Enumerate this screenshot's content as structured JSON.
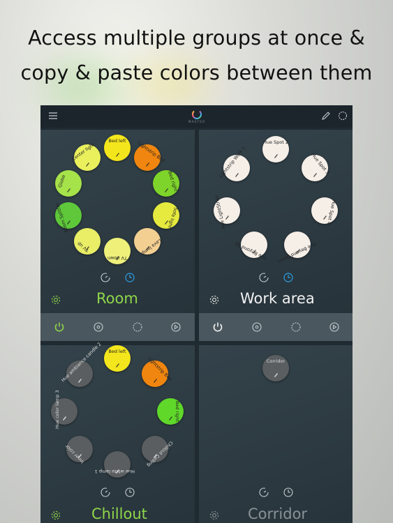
{
  "headline": {
    "line1": "Access multiple groups at once &",
    "line2": "copy & paste colors between them"
  },
  "app": {
    "logo_text": "MASTER",
    "icons": {
      "menu": "menu-icon",
      "edit": "pencil-icon",
      "select": "circle-select-icon"
    }
  },
  "groups": [
    {
      "name": "Room",
      "name_color": "#8fd64a",
      "lights": [
        {
          "label": "Bed left",
          "color": "#f4e61c"
        },
        {
          "label": "Lightstrip Bed",
          "color": "#f0860f"
        },
        {
          "label": "Bed right",
          "color": "#7ed42a"
        },
        {
          "label": "Sofa light",
          "color": "#e6ea3e"
        },
        {
          "label": "Lava lamp",
          "color": "#f3cf92"
        },
        {
          "label": "TV down",
          "color": "#eef07a"
        },
        {
          "label": "TV up",
          "color": "#e9ee66"
        },
        {
          "label": "Room Splitter",
          "color": "#5ec83a"
        },
        {
          "label": "Globe",
          "color": "#a6e24a"
        },
        {
          "label": "Center light",
          "color": "#eaf05c"
        }
      ],
      "modes": [
        "timer-icon",
        "clock-icon"
      ],
      "active_mode": 1
    },
    {
      "name": "Work area",
      "name_color": "#f2f2f2",
      "lights": [
        {
          "label": "Hue Spot 2",
          "color": "#f6efe8"
        },
        {
          "label": "Hue Spot 3",
          "color": "#f6efe8"
        },
        {
          "label": "Hue Spot 4",
          "color": "#f6efe8"
        },
        {
          "label": "Hue Beyond Down",
          "color": "#f6efe8"
        },
        {
          "label": "Hue Beyond Up",
          "color": "#f6efe8"
        },
        {
          "label": "Hue LightStrips",
          "color": "#f6efe8"
        },
        {
          "label": "Lightstrip Work 2",
          "color": "#f6efe8"
        }
      ],
      "modes": [
        "timer-icon",
        "clock-icon"
      ],
      "active_mode": 1
    },
    {
      "name": "Chillout",
      "name_color": "#8fd64a",
      "lights": [
        {
          "label": "Bed left",
          "color": "#f4e61c"
        },
        {
          "label": "Lightstrip Bed",
          "color": "#f0860f"
        },
        {
          "label": "Bed right",
          "color": "#5fd82a"
        },
        {
          "label": "Chillout Ceiling",
          "color": "#5a5e60"
        },
        {
          "label": "Hue white lamp 1",
          "color": "#5a5e60"
        },
        {
          "label": "Inner color",
          "color": "#5a5e60"
        },
        {
          "label": "Hue color lamp 3",
          "color": "#5a5e60"
        },
        {
          "label": "Hue ambiance candle 2",
          "color": "#5a5e60"
        }
      ],
      "modes": [
        "timer-icon",
        "clock-icon"
      ],
      "active_mode": -1
    },
    {
      "name": "Corridor",
      "name_color": "#8a9296",
      "lights": [
        {
          "label": "Corridor",
          "color": "#5a5e60"
        }
      ],
      "modes": [
        "timer-icon",
        "clock-icon"
      ],
      "active_mode": -1
    }
  ],
  "controls": [
    "power-icon",
    "dot-circle-icon",
    "dashed-circle-icon",
    "play-circle-icon"
  ],
  "accent": "#2e9ee6",
  "power_on_color": "#8fd64a"
}
